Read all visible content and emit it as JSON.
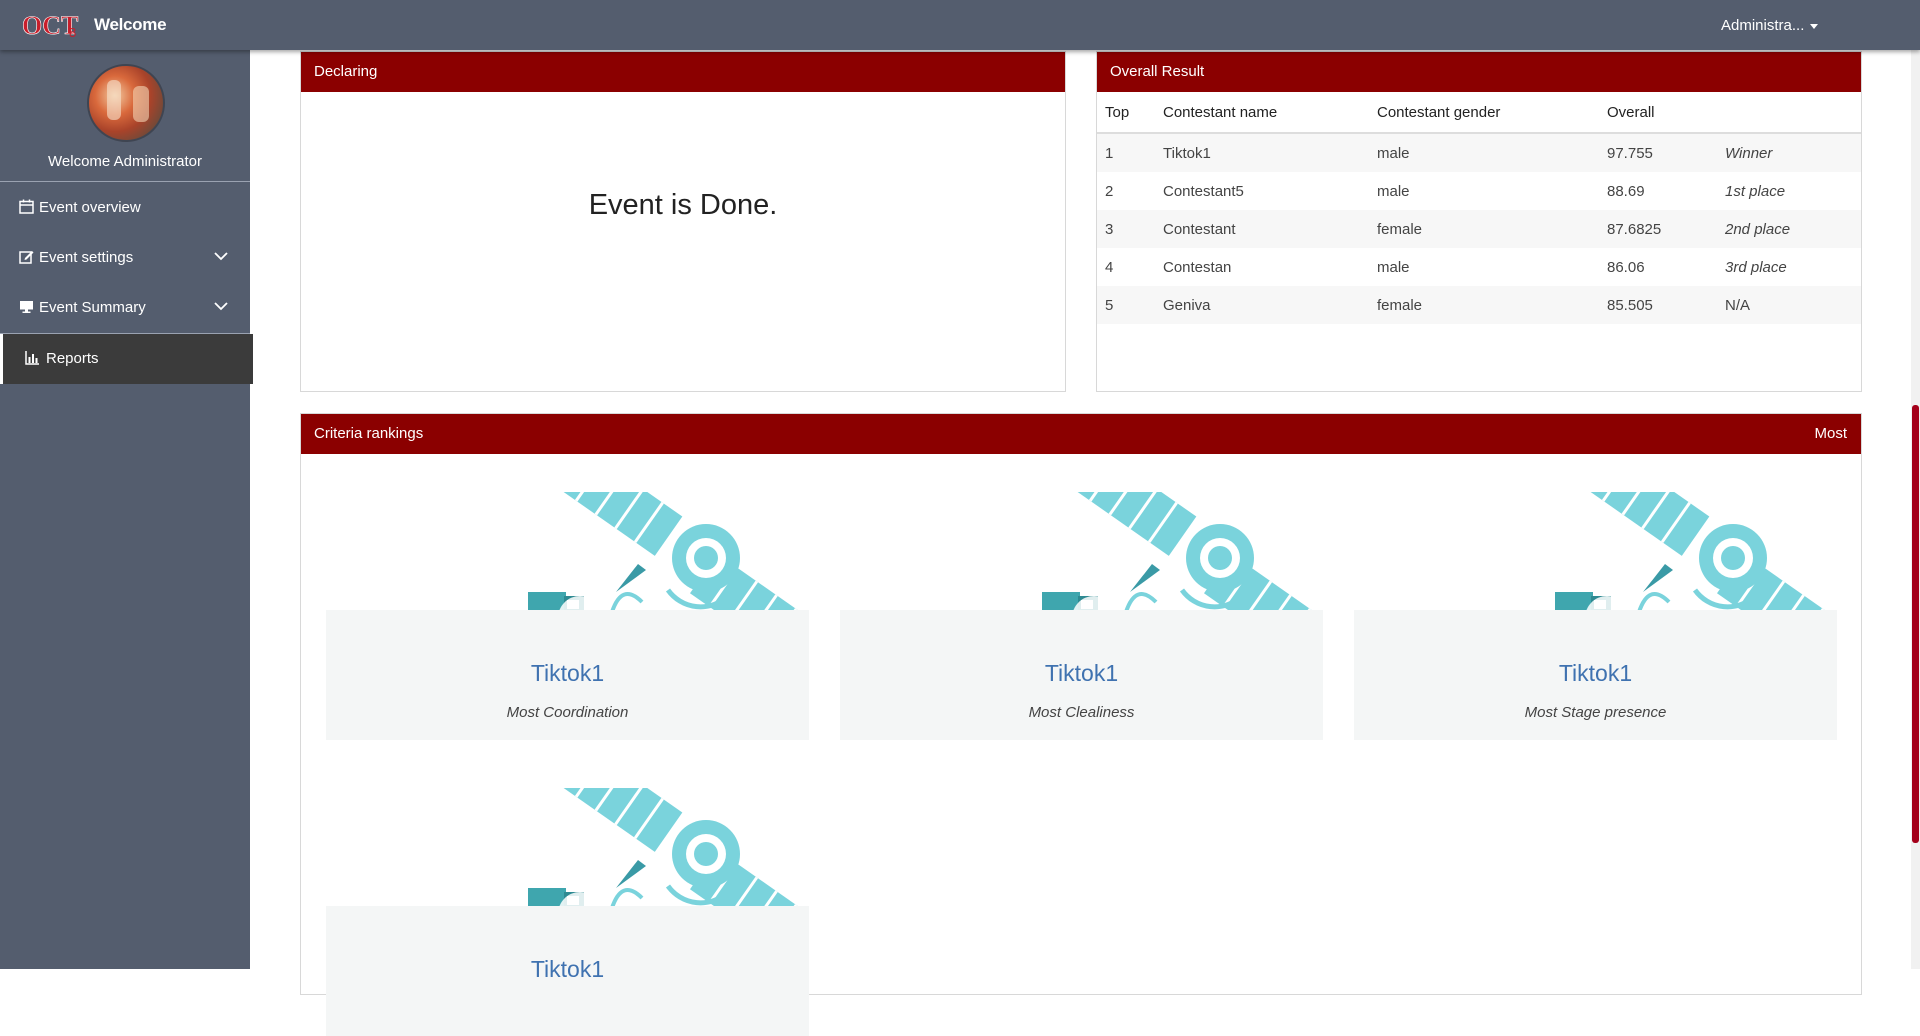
{
  "navbar": {
    "brand": "Welcome",
    "user_menu": "Administra..."
  },
  "sidebar": {
    "welcome": "Welcome Administrator",
    "items": [
      {
        "label": "Event overview",
        "icon": "calendar-icon"
      },
      {
        "label": "Event settings",
        "icon": "edit-icon",
        "expandable": true
      },
      {
        "label": "Event Summary",
        "icon": "desktop-icon",
        "expandable": true
      },
      {
        "label": "Reports",
        "icon": "bar-chart-icon",
        "active": true
      }
    ]
  },
  "declaring": {
    "title": "Declaring",
    "message": "Event is Done."
  },
  "overall": {
    "title": "Overall Result",
    "columns": [
      "Top",
      "Contestant name",
      "Contestant gender",
      "Overall"
    ],
    "rows": [
      {
        "top": "1",
        "name": "Tiktok1",
        "gender": "male",
        "overall": "97.755",
        "place": "Winner"
      },
      {
        "top": "2",
        "name": "Contestant5",
        "gender": "male",
        "overall": "88.69",
        "place": "1st place"
      },
      {
        "top": "3",
        "name": "Contestant",
        "gender": "female",
        "overall": "87.6825",
        "place": "2nd place"
      },
      {
        "top": "4",
        "name": "Contestan",
        "gender": "male",
        "overall": "86.06",
        "place": "3rd place"
      },
      {
        "top": "5",
        "name": "Geniva",
        "gender": "female",
        "overall": "85.505",
        "place": "N/A"
      }
    ]
  },
  "criteria": {
    "title": "Criteria rankings",
    "right_label": "Most",
    "cards": [
      {
        "name": "Tiktok1",
        "award": "Most Coordination"
      },
      {
        "name": "Tiktok1",
        "award": "Most Clealiness"
      },
      {
        "name": "Tiktok1",
        "award": "Most Stage presence"
      },
      {
        "name": "Tiktok1",
        "award": ""
      }
    ]
  },
  "colors": {
    "navbar": "#545d6e",
    "panel_header": "#8b0000",
    "link": "#3f72b0",
    "satellite": "#7ad3dc"
  }
}
